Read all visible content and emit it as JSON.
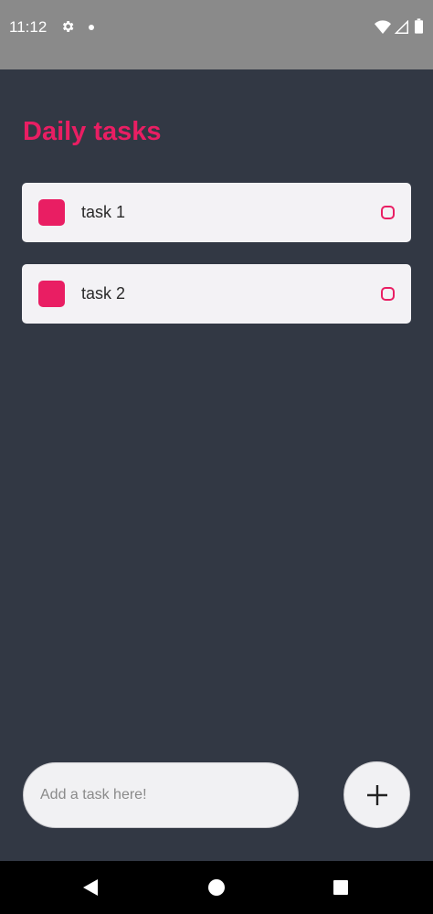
{
  "status_bar": {
    "time": "11:12",
    "icons": [
      "gear-icon",
      "notification-dot-icon",
      "wifi-icon",
      "signal-icon",
      "battery-icon"
    ]
  },
  "header": {
    "title": "Daily tasks"
  },
  "tasks": [
    {
      "label": "task 1"
    },
    {
      "label": "task 2"
    }
  ],
  "composer": {
    "placeholder": "Add a task here!",
    "add_icon": "plus-icon"
  },
  "nav_bar": {
    "icons": [
      "back-icon",
      "home-icon",
      "recents-icon"
    ]
  },
  "colors": {
    "accent": "#e91e63",
    "background": "#323844",
    "card": "#f3f2f5",
    "status_bar": "#8a8a8a",
    "nav_bar": "#000000"
  }
}
